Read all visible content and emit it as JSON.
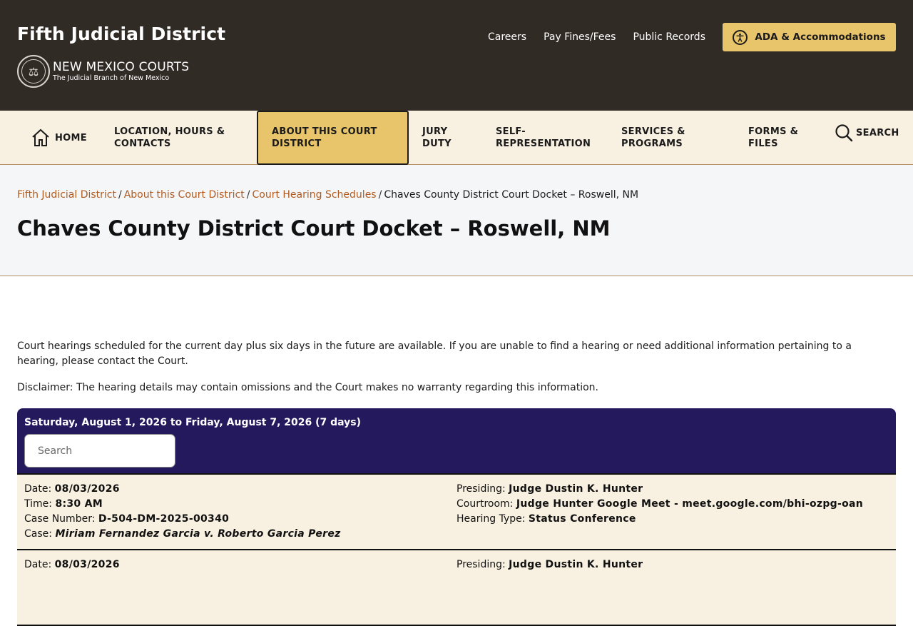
{
  "header": {
    "site_title": "Fifth Judicial District",
    "logo_main": "NEW MEXICO COURTS",
    "logo_sub": "The Judicial Branch of New Mexico",
    "util_links": [
      "Careers",
      "Pay Fines/Fees",
      "Public Records"
    ],
    "ada_label": "ADA & Accommodations"
  },
  "nav": {
    "home": "HOME",
    "location": "LOCATION, HOURS & CONTACTS",
    "about": "ABOUT THIS COURT DISTRICT",
    "jury": "JURY DUTY",
    "self": "SELF-REPRESENTATION",
    "services": "SERVICES & PROGRAMS",
    "forms": "FORMS & FILES",
    "search": "SEARCH"
  },
  "breadcrumb": {
    "items": [
      "Fifth Judicial District",
      "About this Court District",
      "Court Hearing Schedules"
    ],
    "current": "Chaves County District Court Docket – Roswell, NM"
  },
  "page_title": "Chaves County District Court Docket – Roswell, NM",
  "intro": "Court hearings scheduled for the current day plus six days in the future are available. If you are unable to find a hearing or need additional information pertaining to a hearing, please contact the Court.",
  "disclaimer": "Disclaimer:  The hearing details may contain omissions and the Court makes no warranty regarding this information.",
  "docket": {
    "range": "Saturday, August 1, 2026 to Friday, August 7, 2026 (7 days)",
    "search_placeholder": "Search",
    "labels": {
      "date": "Date:",
      "time": "Time:",
      "case_number": "Case Number:",
      "case": "Case:",
      "presiding": "Presiding:",
      "courtroom": "Courtroom:",
      "hearing_type": "Hearing Type:"
    },
    "rows": [
      {
        "date": "08/03/2026",
        "time": "8:30 AM",
        "case_number": "D-504-DM-2025-00340",
        "case": "Miriam Fernandez Garcia v. Roberto Garcia Perez",
        "presiding": "Judge Dustin K. Hunter",
        "courtroom": "Judge Hunter Google Meet - meet.google.com/bhi-ozpg-oan",
        "hearing_type": "Status Conference"
      },
      {
        "date": "08/03/2026",
        "presiding": "Judge Dustin K. Hunter"
      }
    ]
  }
}
